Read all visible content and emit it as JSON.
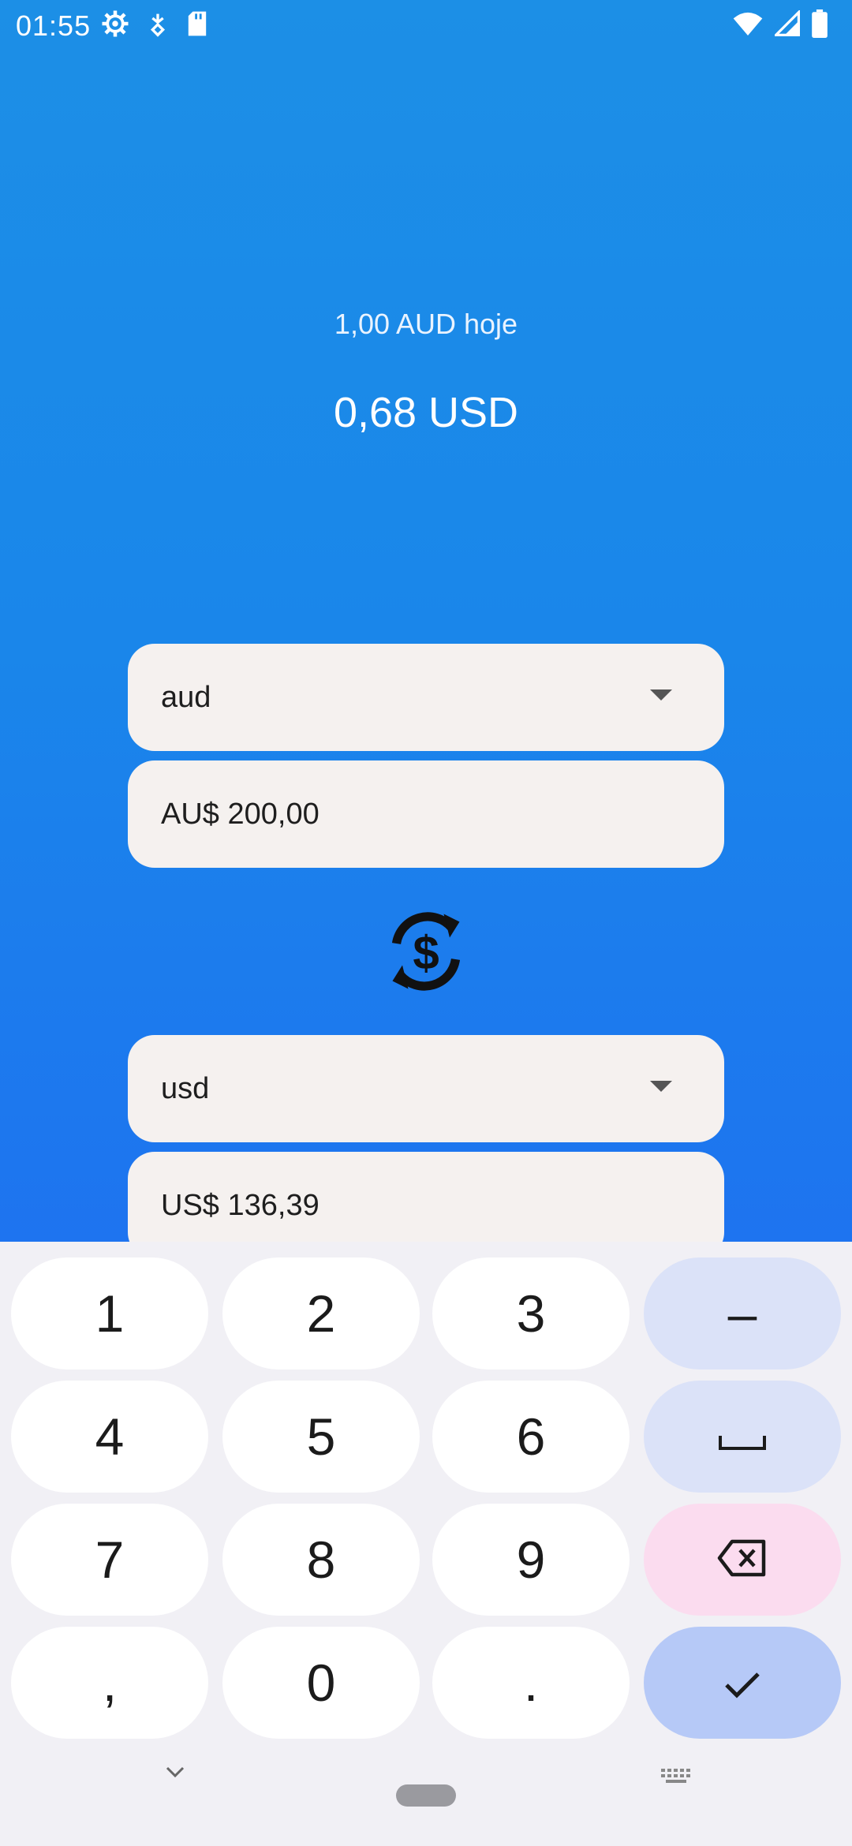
{
  "status_bar": {
    "time": "01:55",
    "icons_left": [
      "settings-icon",
      "location-icon",
      "sd-card-icon"
    ],
    "icons_right": [
      "wifi-icon",
      "signal-icon",
      "battery-icon"
    ]
  },
  "rate": {
    "label": "1,00 AUD hoje",
    "value": "0,68 USD"
  },
  "from": {
    "currency": "aud",
    "amount": "AU$ 200,00"
  },
  "to": {
    "currency": "usd",
    "amount": "US$ 136,39"
  },
  "swap": {
    "icon": "currency-exchange-icon"
  },
  "keyboard": {
    "row1": [
      "1",
      "2",
      "3",
      "–"
    ],
    "row2": [
      "4",
      "5",
      "6"
    ],
    "row3": [
      "7",
      "8",
      "9"
    ],
    "row4": [
      ",",
      "0",
      "."
    ],
    "space_icon": "space-icon",
    "backspace_icon": "backspace-icon",
    "enter_icon": "check-icon"
  },
  "nav": {
    "back_icon": "chevron-down-icon",
    "home_icon": "home-pill-icon",
    "keyboard_icon": "keyboard-switch-icon"
  },
  "colors": {
    "background_top": "#1c8fe6",
    "background_bottom": "#2a6af2",
    "field_bg": "#f5f1ef",
    "key_fn": "#dbe2f8",
    "key_delete": "#fbdcef",
    "key_enter": "#b6c9f7"
  }
}
